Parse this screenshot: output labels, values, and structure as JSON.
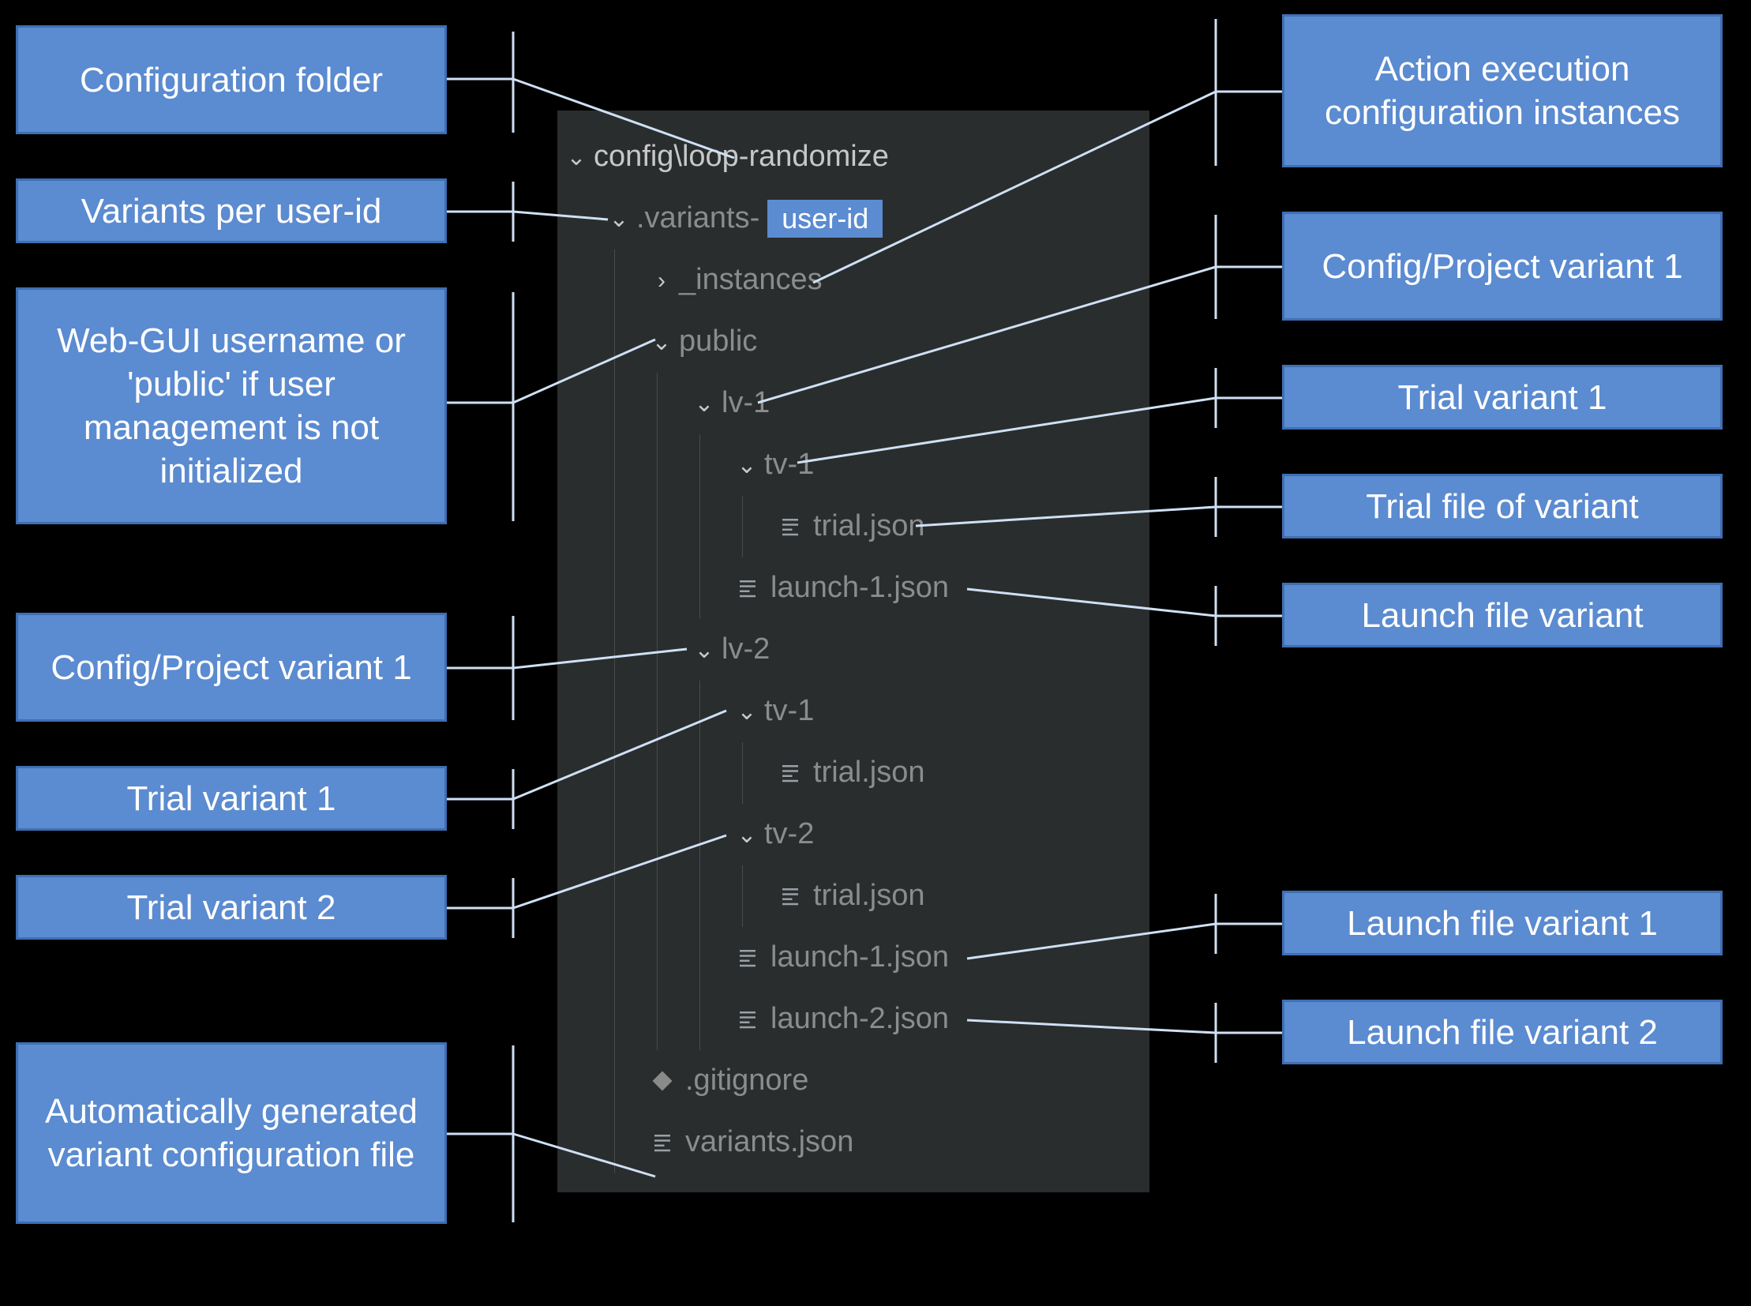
{
  "tree": {
    "root": {
      "label": "config\\loop-randomize"
    },
    "variants_prefix": ".variants-",
    "user_badge": "user-id",
    "instances": "_instances",
    "public": "public",
    "lv1": "lv-1",
    "lv1_tv1": "tv-1",
    "lv1_tv1_trial": "trial.json",
    "lv1_launch1": "launch-1.json",
    "lv2": "lv-2",
    "lv2_tv1": "tv-1",
    "lv2_tv1_trial": "trial.json",
    "lv2_tv2": "tv-2",
    "lv2_tv2_trial": "trial.json",
    "lv2_launch1": "launch-1.json",
    "lv2_launch2": "launch-2.json",
    "gitignore": ".gitignore",
    "variants_json": "variants.json"
  },
  "ann": {
    "left1": "Configuration folder",
    "left2": "Variants per user-id",
    "left3": "Web-GUI username or 'public' if user management is not initialized",
    "left4": "Config/Project variant 1",
    "left5": "Trial variant 1",
    "left6": "Trial variant 2",
    "left7": "Automatically generated variant configuration file",
    "right1": "Action execution configuration instances",
    "right2": "Config/Project variant 1",
    "right3": "Trial variant 1",
    "right4": "Trial file of variant",
    "right5": "Launch file variant",
    "right6": "Launch file variant 1",
    "right7": "Launch file variant 2"
  }
}
